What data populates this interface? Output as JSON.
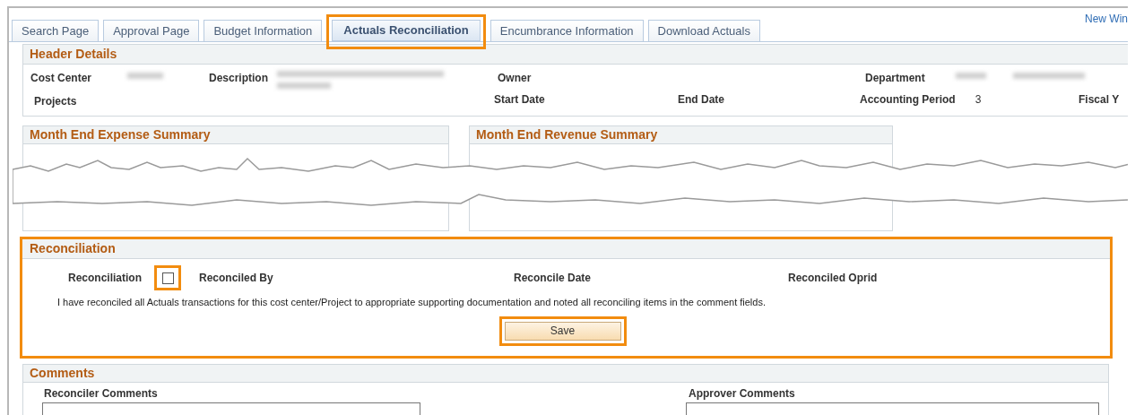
{
  "new_window_link": "New Win",
  "tabs": [
    {
      "label": "Search Page",
      "selected": false,
      "highlighted": false
    },
    {
      "label": "Approval Page",
      "selected": false,
      "highlighted": false
    },
    {
      "label": "Budget Information",
      "selected": false,
      "highlighted": false
    },
    {
      "label": "Actuals Reconciliation",
      "selected": true,
      "highlighted": true
    },
    {
      "label": "Encumbrance Information",
      "selected": false,
      "highlighted": false
    },
    {
      "label": "Download Actuals",
      "selected": false,
      "highlighted": false
    }
  ],
  "header_details": {
    "title": "Header Details",
    "row_1": [
      {
        "label": "Cost Center",
        "blurred": true
      },
      {
        "label": "Description",
        "blurred": true
      },
      {
        "label": "Owner",
        "blurred": false
      },
      {
        "label": "Department",
        "blurred": true
      }
    ],
    "row_2": [
      {
        "label": "Projects"
      },
      {
        "label": "Start Date"
      },
      {
        "label": "End Date"
      },
      {
        "label": "Accounting Period",
        "value": "3"
      },
      {
        "label": "Fiscal Y"
      }
    ]
  },
  "expense_summary": {
    "title": "Month End Expense Summary"
  },
  "revenue_summary": {
    "title": "Month End Revenue Summary"
  },
  "reconciliation": {
    "title": "Reconciliation",
    "highlighted": true,
    "checkbox": {
      "label": "Reconciliation",
      "checked": false,
      "highlighted": true
    },
    "labels": [
      "Reconciled By",
      "Reconcile Date",
      "Reconciled Oprid"
    ],
    "statement": "I have reconciled all Actuals transactions for this cost center/Project to appropriate supporting documentation and noted all reconciling items in the comment fields.",
    "save_button": {
      "label": "Save",
      "highlighted": true
    }
  },
  "comments": {
    "title": "Comments",
    "fields": [
      {
        "label": "Reconciler Comments"
      },
      {
        "label": "Approver Comments"
      }
    ]
  }
}
